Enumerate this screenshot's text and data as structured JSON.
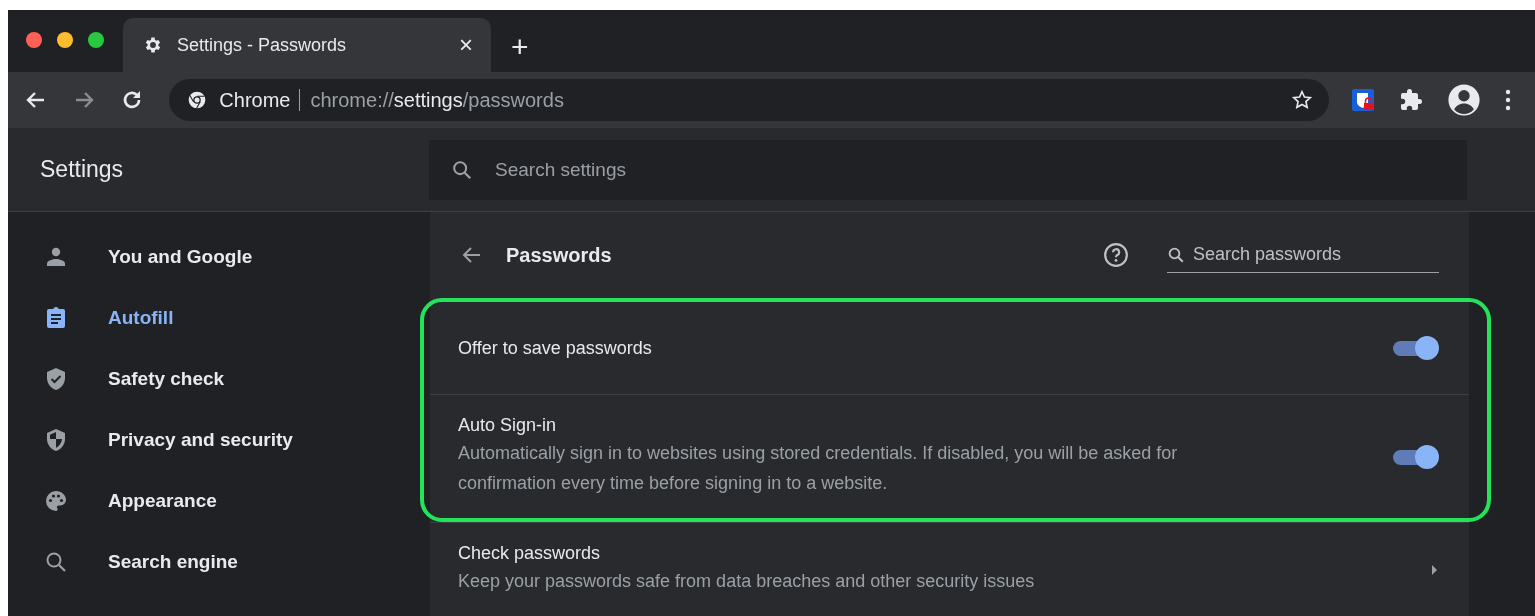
{
  "tabs": [
    {
      "title": "Settings - Passwords",
      "close": "×",
      "selected": true
    }
  ],
  "new_tab": "+",
  "nav_buttons": [
    {
      "kind": "back",
      "disabled": false
    },
    {
      "kind": "forward",
      "disabled": true
    },
    {
      "kind": "reload",
      "disabled": false
    }
  ],
  "omnibox": {
    "site_label": "Chrome",
    "url_scheme": "chrome://",
    "url_host": "settings",
    "url_path": "/passwords"
  },
  "settings_header": {
    "title": "Settings",
    "search": {
      "placeholder": "Search settings"
    }
  },
  "sidebar": {
    "items": [
      {
        "kind": "person",
        "label": "You and Google",
        "selected": false
      },
      {
        "kind": "clipboard",
        "label": "Autofill",
        "selected": true
      },
      {
        "kind": "shield-check",
        "label": "Safety check",
        "selected": false
      },
      {
        "kind": "shield-half",
        "label": "Privacy and security",
        "selected": false
      },
      {
        "kind": "palette",
        "label": "Appearance",
        "selected": false
      },
      {
        "kind": "search",
        "label": "Search engine",
        "selected": false
      }
    ]
  },
  "page": {
    "title": "Passwords",
    "search": {
      "placeholder": "Search passwords"
    },
    "rows": [
      {
        "kind": "toggle",
        "title": "Offer to save passwords",
        "on": true,
        "highlighted": true
      },
      {
        "kind": "toggle",
        "title": "Auto Sign-in",
        "description": "Automatically sign in to websites using stored credentials. If disabled, you will be asked for confirmation every time before signing in to a website.",
        "on": true,
        "highlighted": true
      },
      {
        "kind": "link",
        "title": "Check passwords",
        "description": "Keep your passwords safe from data breaches and other security issues",
        "highlighted": false
      }
    ]
  }
}
